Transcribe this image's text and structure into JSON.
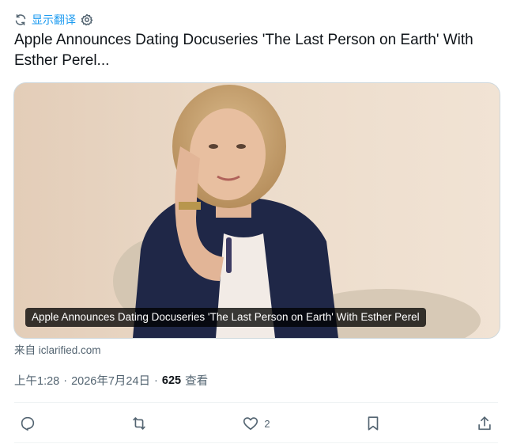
{
  "translate": {
    "label": "显示翻译"
  },
  "tweet": {
    "text": "Apple Announces Dating Docuseries 'The Last Person on Earth' With Esther Perel..."
  },
  "card": {
    "caption": "Apple Announces Dating Docuseries 'The Last Person on Earth' With Esther Perel",
    "source": "来自 iclarified.com"
  },
  "meta": {
    "time": "上午1:28",
    "separator": "·",
    "date": "2026年7月24日",
    "views_count": "625",
    "views_label": "查看"
  },
  "actions": {
    "reply_icon": "reply-icon",
    "retweet_icon": "retweet-icon",
    "like_icon": "heart-icon",
    "like_count": "2",
    "bookmark_icon": "bookmark-icon",
    "share_icon": "share-icon"
  },
  "colors": {
    "accent": "#1d9bf0",
    "secondary_text": "#536471",
    "border": "#cfd9de"
  }
}
